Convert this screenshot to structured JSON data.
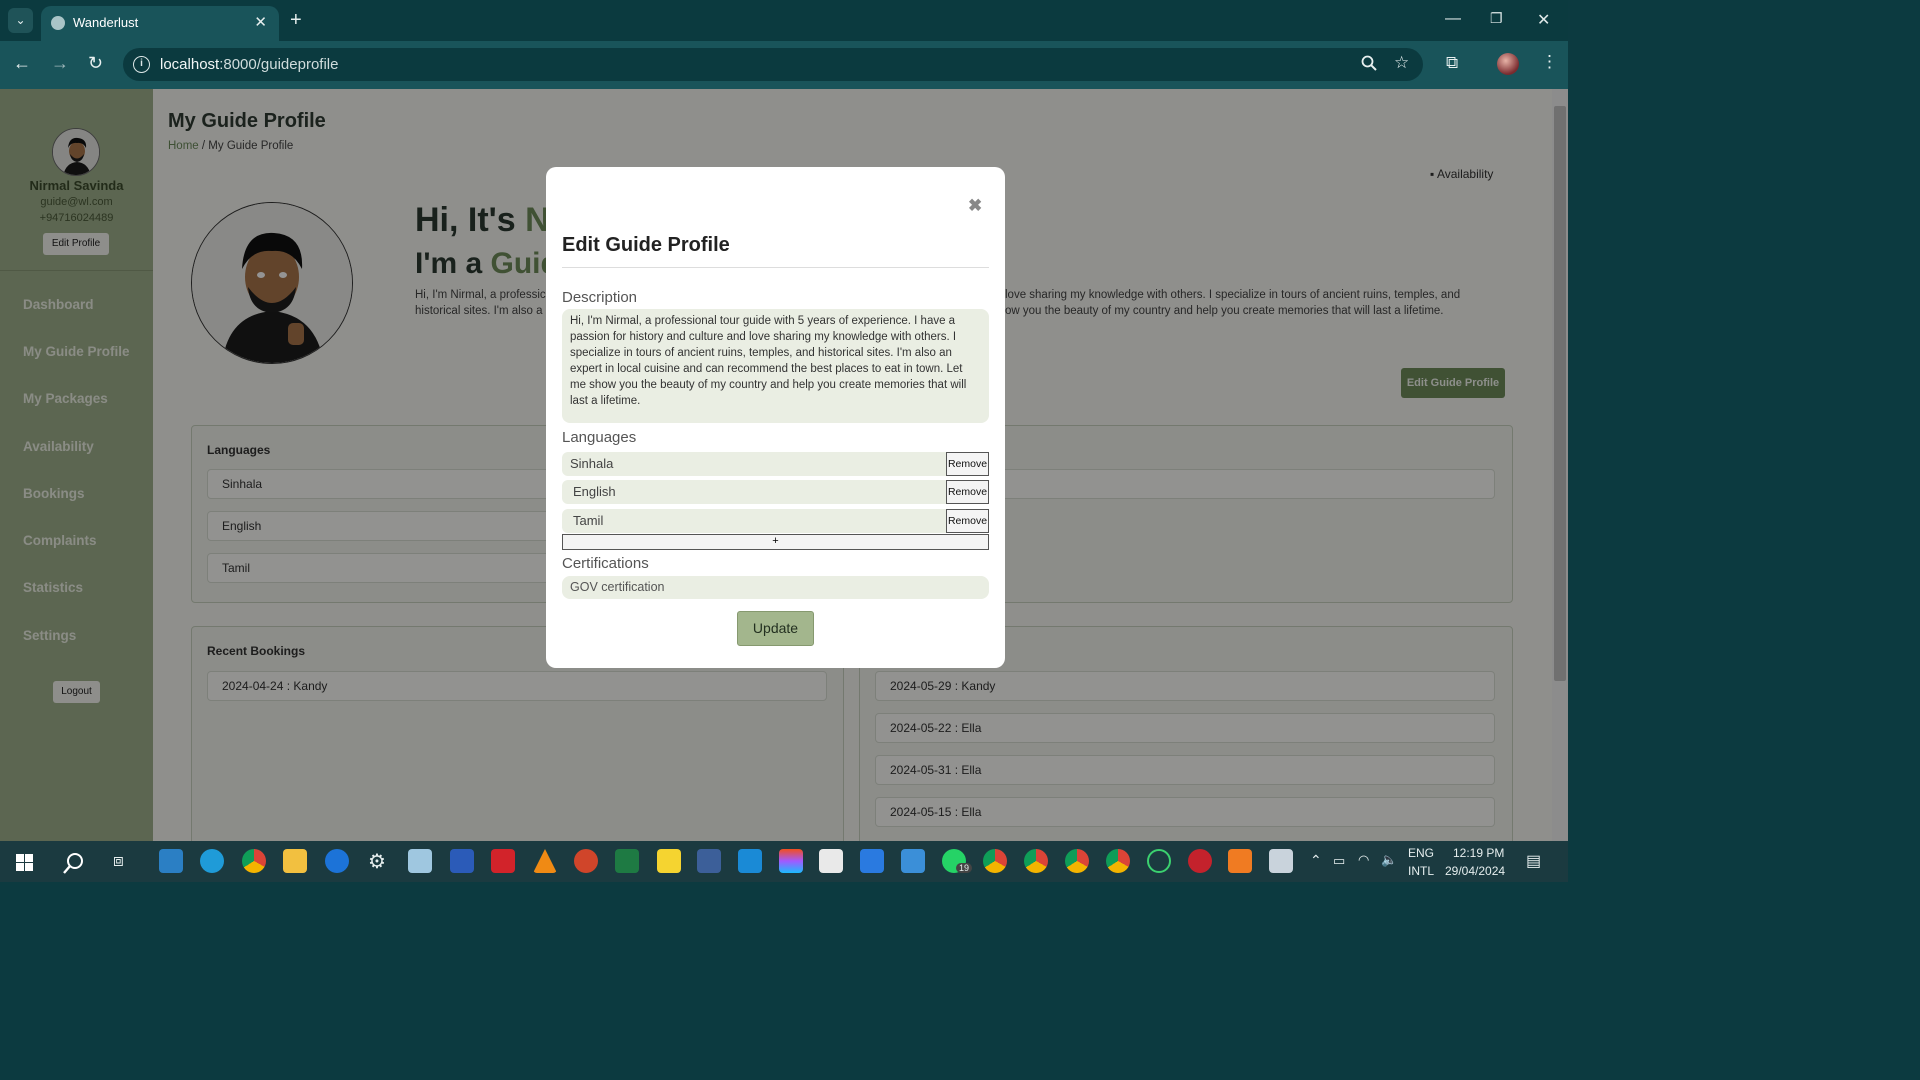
{
  "browser": {
    "tab_title": "Wanderlust",
    "tab_close": "✕",
    "new_tab": "+",
    "url_host": "localhost",
    "url_path": ":8000/guideprofile",
    "icons": [
      "tab-menu-icon",
      "back-icon",
      "forward-icon",
      "reload-icon",
      "info-icon",
      "zoom-icon",
      "star-icon",
      "extensions-icon",
      "profile-icon",
      "more-icon"
    ]
  },
  "sidebar": {
    "name": "Nirmal Savinda",
    "email": "guide@wl.com",
    "phone": "+94716024489",
    "edit_profile": "Edit Profile",
    "items": [
      {
        "label": "Dashboard"
      },
      {
        "label": "My Guide Profile"
      },
      {
        "label": "My Packages"
      },
      {
        "label": "Availability"
      },
      {
        "label": "Bookings"
      },
      {
        "label": "Complaints"
      },
      {
        "label": "Statistics"
      },
      {
        "label": "Settings"
      }
    ],
    "logout": "Logout"
  },
  "main": {
    "title": "My Guide Profile",
    "breadcrumb_home": "Home",
    "breadcrumb_sep": "/",
    "breadcrumb_current": "My Guide Profile",
    "availability_link": "Availability",
    "hi_prefix": "Hi, It's ",
    "hi_name": "Ni",
    "im_prefix": "I'm a ",
    "im_role": "Guid",
    "intro_left_1": "Hi, I'm Nirmal, a professic",
    "intro_left_2": "historical sites. I'm also a",
    "intro_right_1": "love sharing my knowledge with others. I specialize in tours of ancient ruins, temples, and",
    "intro_right_2": "ow you the beauty of my country and help you create memories that will last a lifetime.",
    "edit_guide_profile": "Edit Guide Profile",
    "languages_title": "Languages",
    "languages": [
      "Sinhala",
      "English",
      "Tamil"
    ],
    "recent_title": "Recent Bookings",
    "recent": [
      "2024-04-24 : Kandy"
    ],
    "upcoming": [
      "2024-05-29 : Kandy",
      "2024-05-22 : Ella",
      "2024-05-31 : Ella",
      "2024-05-15 : Ella"
    ]
  },
  "modal": {
    "close": "✖",
    "title": "Edit Guide Profile",
    "description_label": "Description",
    "description": "Hi, I'm Nirmal, a professional tour guide with 5 years of experience. I have a passion for history and culture and love sharing my knowledge with others. I specialize in tours of ancient ruins, temples, and historical sites. I'm also an expert in local cuisine and can recommend the best places to eat in town. Let me show you the beauty of my country and help you create memories that will last a lifetime.",
    "languages_label": "Languages",
    "languages": [
      "Sinhala",
      "English",
      "Tamil"
    ],
    "remove_label": "Remove",
    "add_label": "+",
    "certifications_label": "Certifications",
    "certification": "GOV certification",
    "update": "Update"
  },
  "taskbar": {
    "lang_1": "ENG",
    "lang_2": "INTL",
    "time": "12:19 PM",
    "date": "29/04/2024",
    "whatsapp_badge": "19"
  }
}
